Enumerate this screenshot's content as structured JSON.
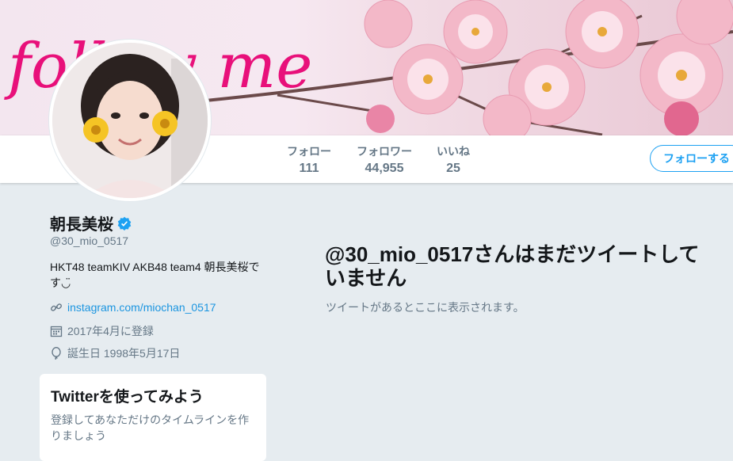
{
  "banner": {
    "script_text": "follow me"
  },
  "nav": {
    "stats": [
      {
        "label": "フォロー",
        "value": "111"
      },
      {
        "label": "フォロワー",
        "value": "44,955"
      },
      {
        "label": "いいね",
        "value": "25"
      }
    ],
    "follow_button": "フォローする"
  },
  "profile": {
    "name": "朝長美桜",
    "handle": "@30_mio_0517",
    "bio": "HKT48 teamKIV AKB48 team4 朝長美桜です◡̈",
    "link": "instagram.com/miochan_0517",
    "joined": "2017年4月に登録",
    "birthday": "誕生日 1998年5月17日"
  },
  "signup_card": {
    "title": "Twitterを使ってみよう",
    "text": "登録してあなただけのタイムラインを作りましょう"
  },
  "main": {
    "empty_title": "@30_mio_0517さんはまだツイートしていません",
    "empty_subtitle": "ツイートがあるとここに表示されます。"
  },
  "colors": {
    "accent": "#1da1f2",
    "link": "#1b95e0",
    "background": "#e6ecf0",
    "banner_script": "#e8107a"
  }
}
